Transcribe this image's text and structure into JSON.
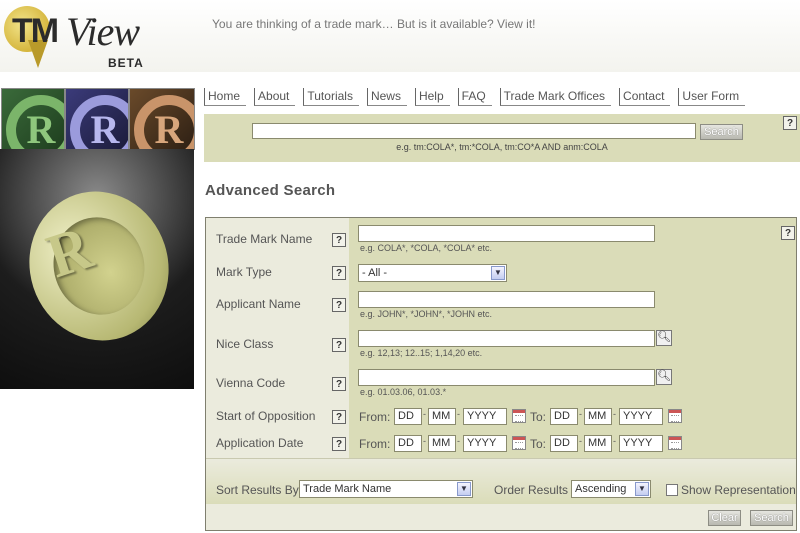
{
  "header": {
    "logo_tm": "TM",
    "logo_view": "View",
    "logo_beta": "BETA",
    "tagline": "You are thinking of a trade mark… But is it available? View it!"
  },
  "nav": [
    "Home",
    "About",
    "Tutorials",
    "News",
    "Help",
    "FAQ",
    "Trade Mark Offices",
    "Contact",
    "User Form"
  ],
  "quick_search": {
    "value": "",
    "button": "Search",
    "hint": "e.g. tm:COLA*, tm:*COLA, tm:CO*A AND anm:COLA",
    "help": "?"
  },
  "advanced": {
    "title": "Advanced Search",
    "help": "?",
    "fields": {
      "trade_mark_name": {
        "label": "Trade Mark Name",
        "hint": "e.g. COLA*, *COLA, *COLA* etc."
      },
      "mark_type": {
        "label": "Mark Type",
        "selected": "- All -"
      },
      "applicant_name": {
        "label": "Applicant Name",
        "hint": "e.g. JOHN*, *JOHN*, *JOHN etc."
      },
      "nice_class": {
        "label": "Nice Class",
        "hint": "e.g. 12,13; 12..15; 1,14,20 etc."
      },
      "vienna_code": {
        "label": "Vienna Code",
        "hint": "e.g. 01.03.06, 01.03.*"
      },
      "start_of_opposition": {
        "label": "Start of Opposition"
      },
      "application_date": {
        "label": "Application Date"
      }
    },
    "date": {
      "from": "From:",
      "to": "To:",
      "dd": "DD",
      "mm": "MM",
      "yyyy": "YYYY",
      "sep": "-"
    },
    "sort": {
      "label": "Sort Results By",
      "selected": "Trade Mark Name"
    },
    "order": {
      "label": "Order Results",
      "selected": "Ascending"
    },
    "show_representation": "Show Representation",
    "clear_button": "Clear",
    "search_button": "Search"
  },
  "images": {
    "tile_letters": [
      "R",
      "R",
      "R"
    ],
    "big_letter": "R"
  },
  "colors": {
    "panel": "#dadcb8",
    "label_panel": "#ebebdd",
    "accent": "#b99a2a"
  }
}
